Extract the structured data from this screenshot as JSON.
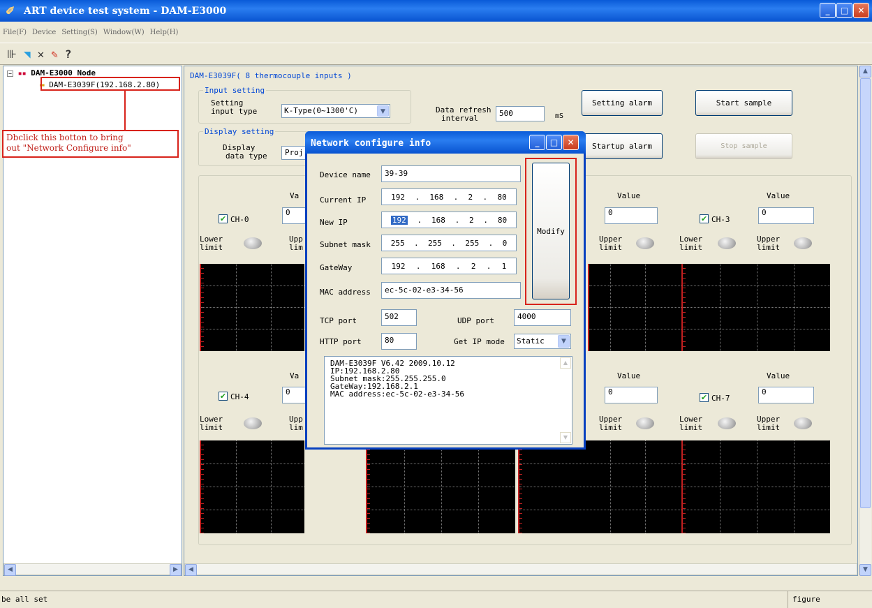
{
  "window": {
    "title": "ART device test system - DAM-E3000"
  },
  "menu": [
    "File(F)",
    "Device",
    "Setting(S)",
    "Window(W)",
    "Help(H)"
  ],
  "toolbar": {
    "icons": [
      "connect-icon",
      "device-icon",
      "delete-icon",
      "settings-icon",
      "help-icon"
    ],
    "glyphs": [
      "⊪",
      "◥",
      "✕",
      "✎",
      "?"
    ]
  },
  "tree": {
    "root": "DAM-E3000 Node",
    "child": "DAM-E3039F(192.168.2.80)"
  },
  "callout": {
    "line1": "Dbclick this botton to bring",
    "line2": "out \"Network Configure info\""
  },
  "panel": {
    "title": "DAM-E3039F( 8 thermocouple inputs )",
    "input_setting": "Input setting",
    "setting_input_type_1": "Setting",
    "setting_input_type_2": "input type",
    "input_type_value": "K-Type(0~1300'C)",
    "refresh_1": "Data refresh",
    "refresh_2": "interval",
    "refresh_value": "500",
    "refresh_unit": "mS",
    "display_setting": "Display setting",
    "display_1": "Display",
    "display_2": "data type",
    "display_value": "Proj",
    "setting_alarm": "Setting alarm",
    "start_sample": "Start sample",
    "startup_alarm": "Startup alarm",
    "stop_sample": "Stop sample"
  },
  "channels": {
    "value_label": "Value",
    "lower_1": "Lower",
    "lower_2": "limit",
    "upper_1": "Upper",
    "upper_2": "limit",
    "ch0": "CH-0",
    "ch3": "CH-3",
    "ch4": "CH-4",
    "ch7": "CH-7",
    "v0": "0",
    "v2": "0",
    "v3": "0",
    "v4": "0",
    "v6": "0",
    "v7": "0",
    "partial_va": "Va",
    "partial_upp": "Upp",
    "partial_lim": "lim"
  },
  "dialog": {
    "title": "Network configure info",
    "device_name_label": "Device name",
    "device_name": "39-39",
    "current_ip_label": "Current IP",
    "current_ip": [
      "192",
      "168",
      "2",
      "80"
    ],
    "new_ip_label": "New IP",
    "new_ip": [
      "192",
      "168",
      "2",
      "80"
    ],
    "subnet_label": "Subnet mask",
    "subnet": [
      "255",
      "255",
      "255",
      "0"
    ],
    "gateway_label": "GateWay",
    "gateway": [
      "192",
      "168",
      "2",
      "1"
    ],
    "mac_label": "MAC address",
    "mac": "ec-5c-02-e3-34-56",
    "modify": "Modify",
    "tcp_label": "TCP port",
    "tcp": "502",
    "udp_label": "UDP port",
    "udp": "4000",
    "http_label": "HTTP port",
    "http": "80",
    "ipmode_label": "Get IP mode",
    "ipmode": "Static",
    "info": "DAM-E3039F V6.42 2009.10.12\nIP:192.168.2.80\nSubnet mask:255.255.255.0\nGateWay:192.168.2.1\nMAC address:ec-5c-02-e3-34-56"
  },
  "status": {
    "left": "be all set",
    "right": "figure"
  }
}
